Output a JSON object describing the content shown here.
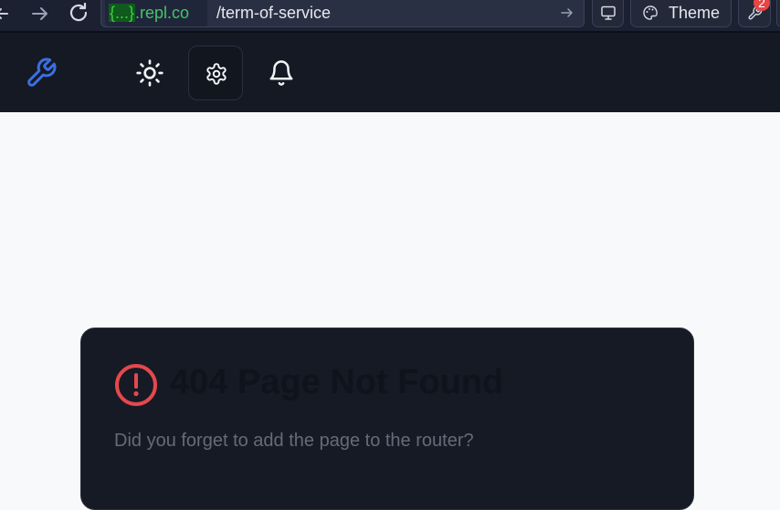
{
  "browser": {
    "url_brace": "{...}",
    "url_host": ".repl.co",
    "url_path": "/term-of-service",
    "theme_label": "Theme",
    "notification_count": "2"
  },
  "icons": {
    "logo": "wrench-icon",
    "theme_toggle": "sun-icon",
    "settings": "gear-icon",
    "notifications": "bell-icon",
    "error": "alert-circle-icon"
  },
  "error": {
    "title": "404 Page Not Found",
    "description": "Did you forget to add the page to the router?"
  },
  "colors": {
    "app_bar": "#151923",
    "card": "#161a24",
    "error_icon": "#e5484d",
    "logo": "#3b6fe0"
  }
}
